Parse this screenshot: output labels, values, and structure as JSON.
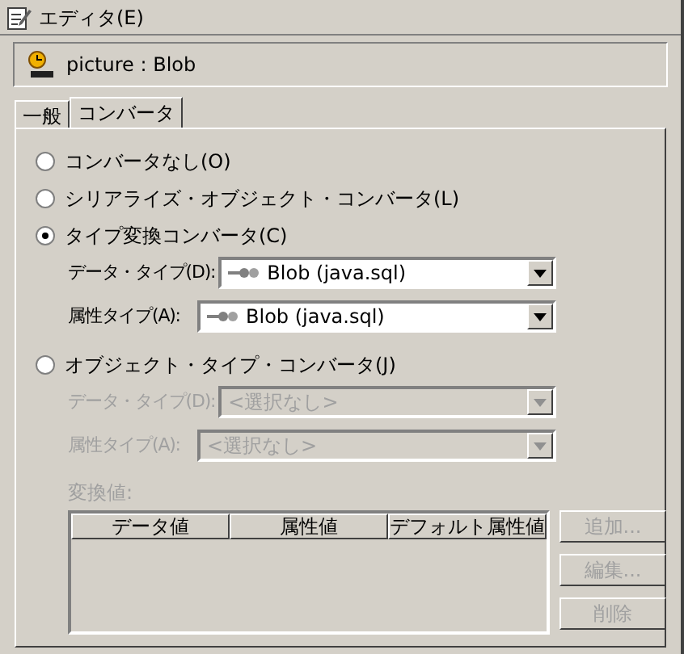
{
  "window": {
    "title": "エディタ(E)"
  },
  "header": {
    "label": "picture : Blob"
  },
  "tabs": [
    {
      "label": "一般",
      "selected": false
    },
    {
      "label": "コンバータ",
      "selected": true
    }
  ],
  "converters": [
    {
      "label": "コンバータなし(O)",
      "selected": false
    },
    {
      "label": "シリアライズ・オブジェクト・コンバータ(L)",
      "selected": false
    },
    {
      "label": "タイプ変換コンバータ(C)",
      "selected": true,
      "fields": [
        {
          "label": "データ・タイプ(D):",
          "value": "Blob (java.sql)",
          "disabled": false
        },
        {
          "label": "属性タイプ(A):",
          "value": "Blob (java.sql)",
          "disabled": false
        }
      ]
    },
    {
      "label": "オブジェクト・タイプ・コンバータ(J)",
      "selected": false,
      "fields": [
        {
          "label": "データ・タイプ(D):",
          "value": "<選択なし>",
          "disabled": true
        },
        {
          "label": "属性タイプ(A):",
          "value": "<選択なし>",
          "disabled": true
        }
      ]
    }
  ],
  "conversion_values": {
    "label": "変換値:",
    "disabled": true,
    "columns": [
      "データ値",
      "属性値",
      "デフォルト属性値"
    ],
    "buttons": [
      {
        "label": "追加...",
        "disabled": true
      },
      {
        "label": "編集...",
        "disabled": true
      },
      {
        "label": "削除",
        "disabled": true
      }
    ]
  }
}
